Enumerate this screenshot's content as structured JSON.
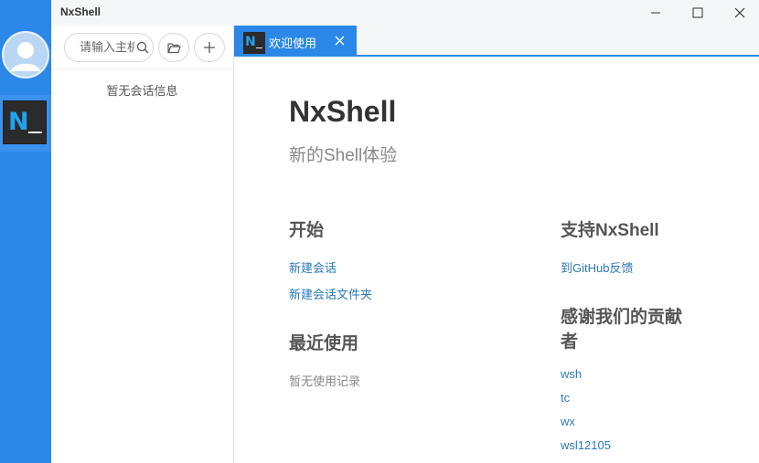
{
  "window": {
    "title": "NxShell",
    "controls": {
      "minimize": "minimize-icon",
      "maximize": "maximize-icon",
      "close": "close-icon"
    }
  },
  "rail": {
    "avatar_icon": "user-avatar-icon",
    "app_icon": "nxshell-terminal-icon",
    "app_icon_text": "N"
  },
  "session_panel": {
    "search": {
      "placeholder": "请输入主机名",
      "icon": "search-icon"
    },
    "folder_button_icon": "folder-open-icon",
    "add_button_icon": "plus-icon",
    "empty_text": "暂无会话信息"
  },
  "tabs": [
    {
      "label": "欢迎使用",
      "icon": "nxshell-terminal-icon",
      "icon_text": "N",
      "active": true
    }
  ],
  "welcome": {
    "title": "NxShell",
    "subtitle": "新的Shell体验",
    "start": {
      "heading": "开始",
      "links": [
        "新建会话",
        "新建会话文件夹"
      ]
    },
    "recent": {
      "heading": "最近使用",
      "empty": "暂无使用记录"
    },
    "support": {
      "heading": "支持NxShell",
      "links": [
        "到GitHub反馈"
      ]
    },
    "thanks": {
      "heading_line1": "感谢我们的贡献",
      "heading_line2": "者",
      "contributors": [
        "wsh",
        "tc",
        "wx",
        "wsl12105"
      ]
    }
  },
  "colors": {
    "accent": "#2b88e9",
    "link": "#2a7ab8",
    "logo_text": "#1ea3f2",
    "logo_bg": "#2b2b2b"
  }
}
